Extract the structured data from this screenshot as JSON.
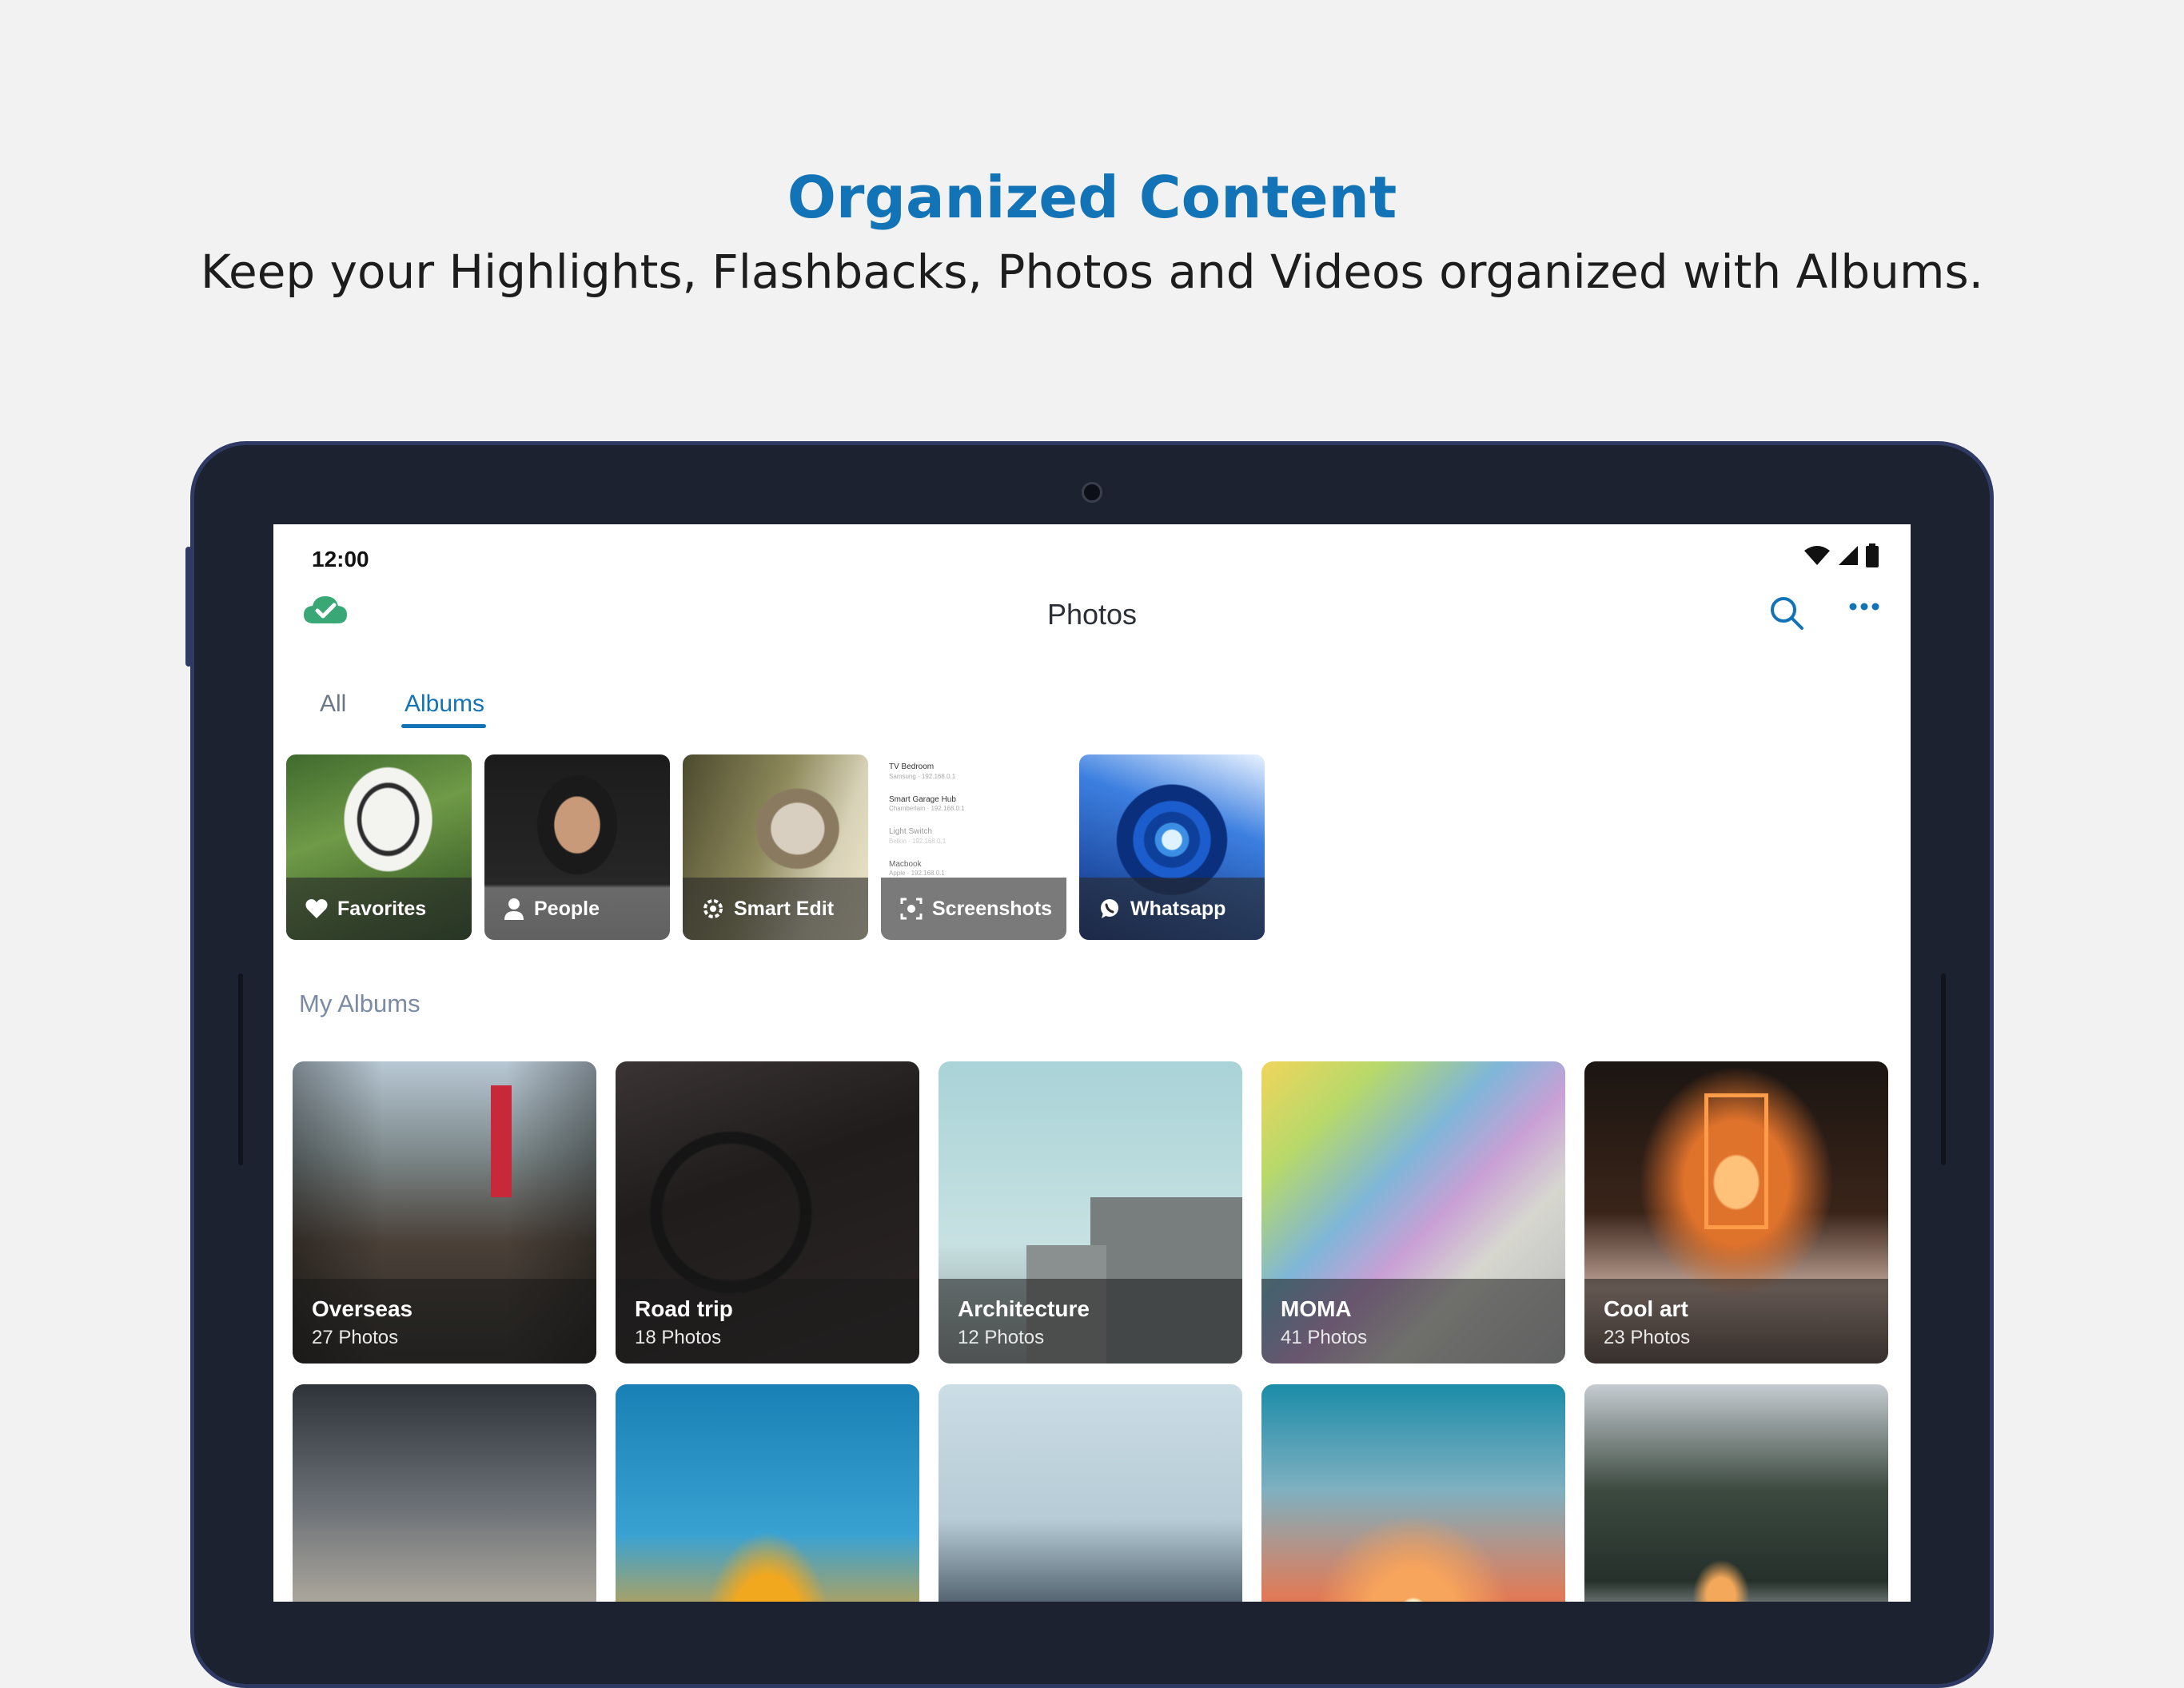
{
  "promo": {
    "title": "Organized Content",
    "subtitle": "Keep your Highlights, Flashbacks, Photos and Videos organized with Albums."
  },
  "status_bar": {
    "time": "12:00"
  },
  "app_bar": {
    "title": "Photos"
  },
  "tabs": [
    {
      "label": "All",
      "selected": false
    },
    {
      "label": "Albums",
      "selected": true
    }
  ],
  "smart_albums": [
    {
      "label": "Favorites",
      "icon": "heart-icon"
    },
    {
      "label": "People",
      "icon": "person-icon"
    },
    {
      "label": "Smart Edit",
      "icon": "gear-icon"
    },
    {
      "label": "Screenshots",
      "icon": "screenshot-icon"
    },
    {
      "label": "Whatsapp",
      "icon": "whatsapp-icon"
    }
  ],
  "screenshot_preview": [
    {
      "name": "TV Bedroom",
      "detail": "Samsung · 192.168.0.1"
    },
    {
      "name": "Smart Garage Hub",
      "detail": "Chamberlain · 192.168.0.1"
    },
    {
      "name": "Light Switch",
      "detail": "Belkin · 192.168.0.1"
    },
    {
      "name": "Macbook",
      "detail": "Apple · 192.168.0.1"
    }
  ],
  "my_albums": {
    "header": "My Albums",
    "albums": [
      {
        "name": "Overseas",
        "count": "27 Photos"
      },
      {
        "name": "Road trip",
        "count": "18 Photos"
      },
      {
        "name": "Architecture",
        "count": "12 Photos"
      },
      {
        "name": "MOMA",
        "count": "41 Photos"
      },
      {
        "name": "Cool art",
        "count": "23 Photos"
      }
    ]
  },
  "colors": {
    "accent": "#1273b6",
    "cloud_sync": "#3aa776",
    "tablet_frame": "#1d2230"
  }
}
